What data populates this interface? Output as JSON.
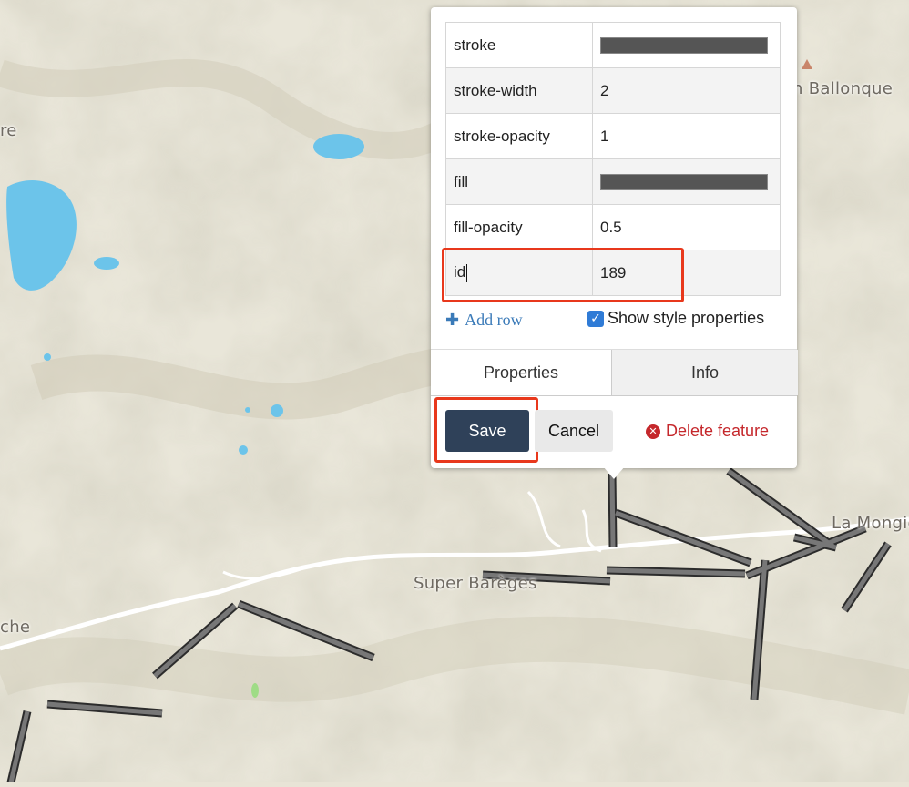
{
  "map": {
    "labels": {
      "ballonque": "n Ballonque",
      "re": "re",
      "super_bareges": "Super Barèges",
      "la_mongie": "La Mongie",
      "che": "che"
    }
  },
  "popup": {
    "rows": [
      {
        "key": "stroke",
        "value": "",
        "swatch_color": "#555555"
      },
      {
        "key": "stroke-width",
        "value": "2"
      },
      {
        "key": "stroke-opacity",
        "value": "1"
      },
      {
        "key": "fill",
        "value": "",
        "swatch_color": "#555555"
      },
      {
        "key": "fill-opacity",
        "value": "0.5"
      },
      {
        "key": "id",
        "value": "189"
      }
    ],
    "add_row": "Add row",
    "show_style": "Show style properties",
    "show_style_checked": true,
    "tabs": [
      "Properties",
      "Info"
    ],
    "active_tab": "Properties",
    "save": "Save",
    "cancel": "Cancel",
    "delete": "Delete feature"
  },
  "colors": {
    "highlight": "#e8381c",
    "save_button": "#2f4159",
    "link_blue": "#3a7ab8",
    "delete_red": "#c5282c"
  }
}
